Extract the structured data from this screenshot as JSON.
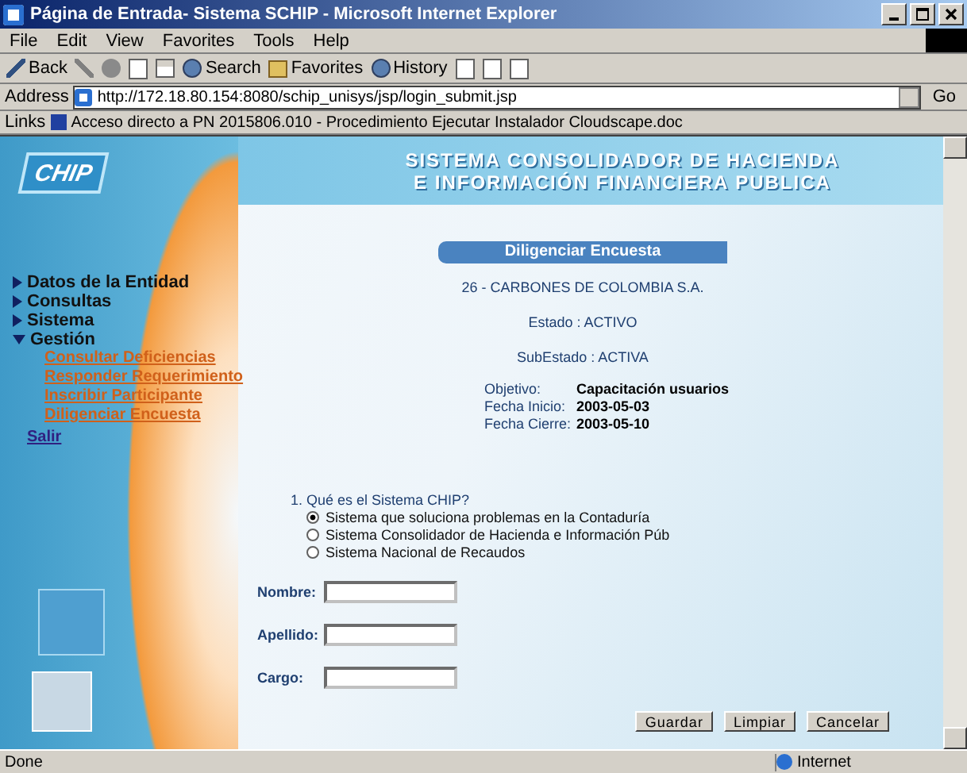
{
  "window": {
    "title": "Página de Entrada- Sistema SCHIP - Microsoft Internet Explorer"
  },
  "menu": [
    "File",
    "Edit",
    "View",
    "Favorites",
    "Tools",
    "Help"
  ],
  "toolbar": {
    "back": "Back",
    "search": "Search",
    "favorites": "Favorites",
    "history": "History"
  },
  "address": {
    "label": "Address",
    "value": "http://172.18.80.154:8080/schip_unisys/jsp/login_submit.jsp",
    "go": "Go"
  },
  "links": {
    "label": "Links",
    "item": "Acceso directo a PN 2015806.010 - Procedimiento Ejecutar Instalador Cloudscape.doc"
  },
  "banner": {
    "logo": "CHIP",
    "line_1": "SISTEMA CONSOLIDADOR DE HACIENDA",
    "line_2": "E INFORMACIÓN FINANCIERA PUBLICA"
  },
  "sidebar": {
    "items": [
      {
        "label": "Datos de la Entidad",
        "expanded": false
      },
      {
        "label": "Consultas",
        "expanded": false
      },
      {
        "label": "Sistema",
        "expanded": false
      },
      {
        "label": "Gestión",
        "expanded": true,
        "children": [
          {
            "label": "Consultar Deficiencias"
          },
          {
            "label": "Responder Requerimiento"
          },
          {
            "label": "Inscribir Participante"
          },
          {
            "label": "Diligenciar Encuesta"
          }
        ]
      }
    ],
    "exit": "Salir"
  },
  "form": {
    "heading": "Diligenciar Encuesta",
    "entity": "26 - CARBONES DE COLOMBIA S.A.",
    "estado": "Estado : ACTIVO",
    "subestado": "SubEstado : ACTIVA",
    "details": [
      {
        "label": "Objetivo:",
        "value": "Capacitación usuarios"
      },
      {
        "label": "Fecha Inicio:",
        "value": "2003-05-03"
      },
      {
        "label": "Fecha Cierre:",
        "value": "2003-05-10"
      }
    ],
    "question": "1. Qué es el Sistema CHIP?",
    "options": [
      {
        "label": "Sistema que soluciona problemas en la Contaduría",
        "selected": true
      },
      {
        "label": "Sistema Consolidador de Hacienda e Información Púb",
        "selected": false
      },
      {
        "label": "Sistema Nacional de Recaudos",
        "selected": false
      }
    ],
    "fields": [
      {
        "label": "Nombre:"
      },
      {
        "label": "Apellido:"
      },
      {
        "label": "Cargo:"
      }
    ],
    "buttons": [
      "Guardar",
      "Limpiar",
      "Cancelar"
    ]
  },
  "status_bar": {
    "text": "Done",
    "zone": "Internet"
  }
}
